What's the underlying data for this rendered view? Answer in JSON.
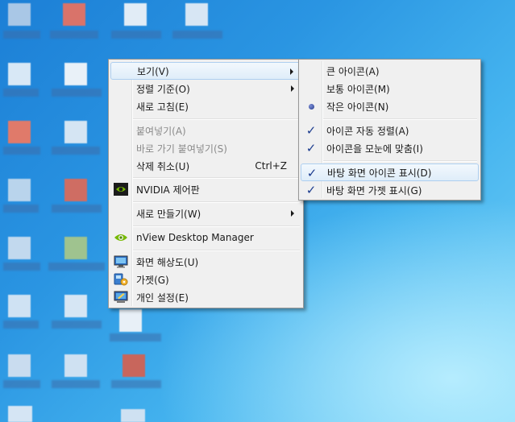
{
  "main_menu": {
    "items": [
      {
        "label": "보기(V)",
        "submenu": true,
        "highlighted": true
      },
      {
        "label": "정렬 기준(O)",
        "submenu": true
      },
      {
        "label": "새로 고침(E)"
      },
      {
        "label": "붙여넣기(A)",
        "disabled": true
      },
      {
        "label": "바로 가기 붙여넣기(S)",
        "disabled": true
      },
      {
        "label": "삭제 취소(U)",
        "shortcut": "Ctrl+Z"
      },
      {
        "label": "NVIDIA 제어판",
        "icon": "nvidia-icon"
      },
      {
        "label": "새로 만들기(W)",
        "submenu": true
      },
      {
        "label": "nView Desktop Manager",
        "icon": "nview-icon"
      },
      {
        "label": "화면 해상도(U)",
        "icon": "display-resolution-icon"
      },
      {
        "label": "가젯(G)",
        "icon": "gadgets-icon"
      },
      {
        "label": "개인 설정(E)",
        "icon": "personalize-icon"
      }
    ]
  },
  "view_submenu": {
    "items": [
      {
        "label": "큰 아이콘(A)"
      },
      {
        "label": "보통 아이콘(M)"
      },
      {
        "label": "작은 아이콘(N)",
        "state": "radio-selected"
      },
      {
        "label": "아이콘 자동 정렬(A)",
        "state": "checked"
      },
      {
        "label": "아이콘을 모눈에 맞춤(I)",
        "state": "checked"
      },
      {
        "label": "바탕 화면 아이콘 표시(D)",
        "state": "checked",
        "highlighted": true
      },
      {
        "label": "바탕 화면 가젯 표시(G)",
        "state": "checked"
      }
    ]
  },
  "icons": {
    "check": "✓",
    "radio": "bullet-icon",
    "submenu": "chevron-right-icon"
  },
  "colors": {
    "menu_background": "#f0f0f0",
    "highlight_border": "#aecff0",
    "desktop_blue": "#2a95e2"
  }
}
